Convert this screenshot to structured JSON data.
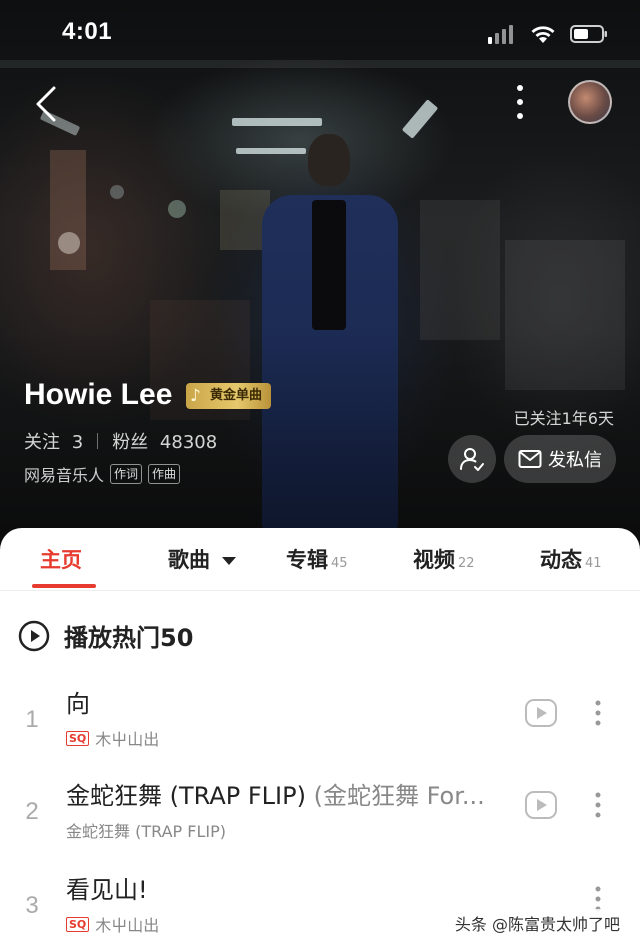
{
  "status_bar": {
    "time": "4:01"
  },
  "artist": {
    "name": "Howie Lee",
    "badge": "黄金单曲",
    "following_label": "关注",
    "following_count": "3",
    "fans_label": "粉丝",
    "fans_count": "48308",
    "identity": "网易音乐人",
    "roles": [
      "作词",
      "作曲"
    ],
    "followed_since": "已关注1年6天",
    "message_button": "发私信"
  },
  "tabs": [
    {
      "label": "主页",
      "count": ""
    },
    {
      "label": "歌曲",
      "count": ""
    },
    {
      "label": "专辑",
      "count": "45"
    },
    {
      "label": "视频",
      "count": "22"
    },
    {
      "label": "动态",
      "count": "41"
    }
  ],
  "play_all": {
    "label": "播放热门50"
  },
  "songs": [
    {
      "index": "1",
      "title": "向",
      "alias": "",
      "badge": "SQ",
      "subtitle": "木屮山出"
    },
    {
      "index": "2",
      "title": "金蛇狂舞 (TRAP FLIP)",
      "alias": "(金蛇狂舞 For...",
      "badge": "",
      "subtitle": "金蛇狂舞 (TRAP FLIP)"
    },
    {
      "index": "3",
      "title": "看见山!",
      "alias": "",
      "badge": "SQ",
      "subtitle": "木屮山出"
    }
  ],
  "watermark": "头条 @陈富贵太帅了吧",
  "colors": {
    "accent": "#e63b2e",
    "gold_badge": "#d9b85a"
  },
  "icons": [
    "back-arrow-icon",
    "more-vertical-icon",
    "user-check-icon",
    "mail-icon",
    "play-circle-icon",
    "video-play-icon",
    "caret-down-icon",
    "signal-icon",
    "wifi-icon",
    "battery-icon",
    "music-note-icon"
  ]
}
